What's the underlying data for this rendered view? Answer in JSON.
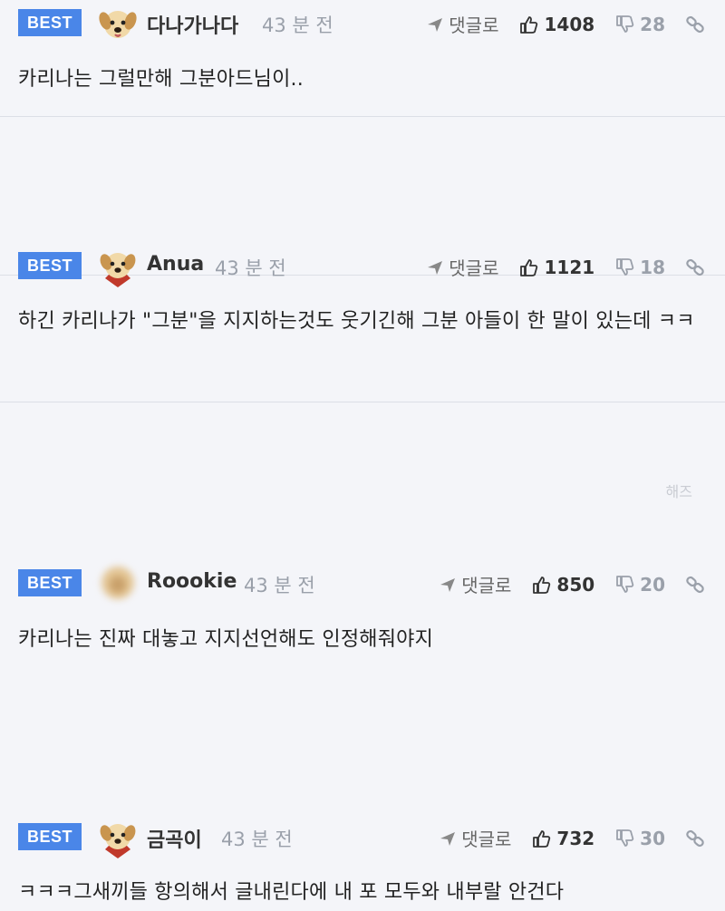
{
  "comments": [
    {
      "badge": "BEST",
      "avatar": "puppy-avatar",
      "nickname": "다나가나다",
      "time": "43 분 전",
      "reply_label": "댓글로",
      "likes": "1408",
      "dislikes": "28",
      "text": "카리나는 그럴만해 그분아드님이.."
    },
    {
      "badge": "BEST",
      "avatar": "puppy-cape-avatar",
      "nickname": "Anua",
      "time": "43 분 전",
      "reply_label": "댓글로",
      "likes": "1121",
      "dislikes": "18",
      "text": "하긴 카리나가 \"그분\"을 지지하는것도 웃기긴해 그분 아들이 한 말이 있는데 ㅋㅋ"
    },
    {
      "badge": "BEST",
      "avatar": "blurred-avatar",
      "nickname": "Roookie",
      "time": "43 분 전",
      "reply_label": "댓글로",
      "likes": "850",
      "dislikes": "20",
      "text": "카리나는 진짜 대놓고 지지선언해도 인정해줘야지"
    },
    {
      "badge": "BEST",
      "avatar": "puppy-cape-avatar",
      "nickname": "금곡이",
      "time": "43 분 전",
      "reply_label": "댓글로",
      "likes": "732",
      "dislikes": "30",
      "text": "ㅋㅋㅋ그새끼들 항의해서 글내린다에 내 포 모두와 내부랄 안건다"
    }
  ],
  "watermark": "해즈",
  "colors": {
    "badge": "#4a86e8",
    "background": "#f4f5f9",
    "muted": "#9aa0aa"
  }
}
